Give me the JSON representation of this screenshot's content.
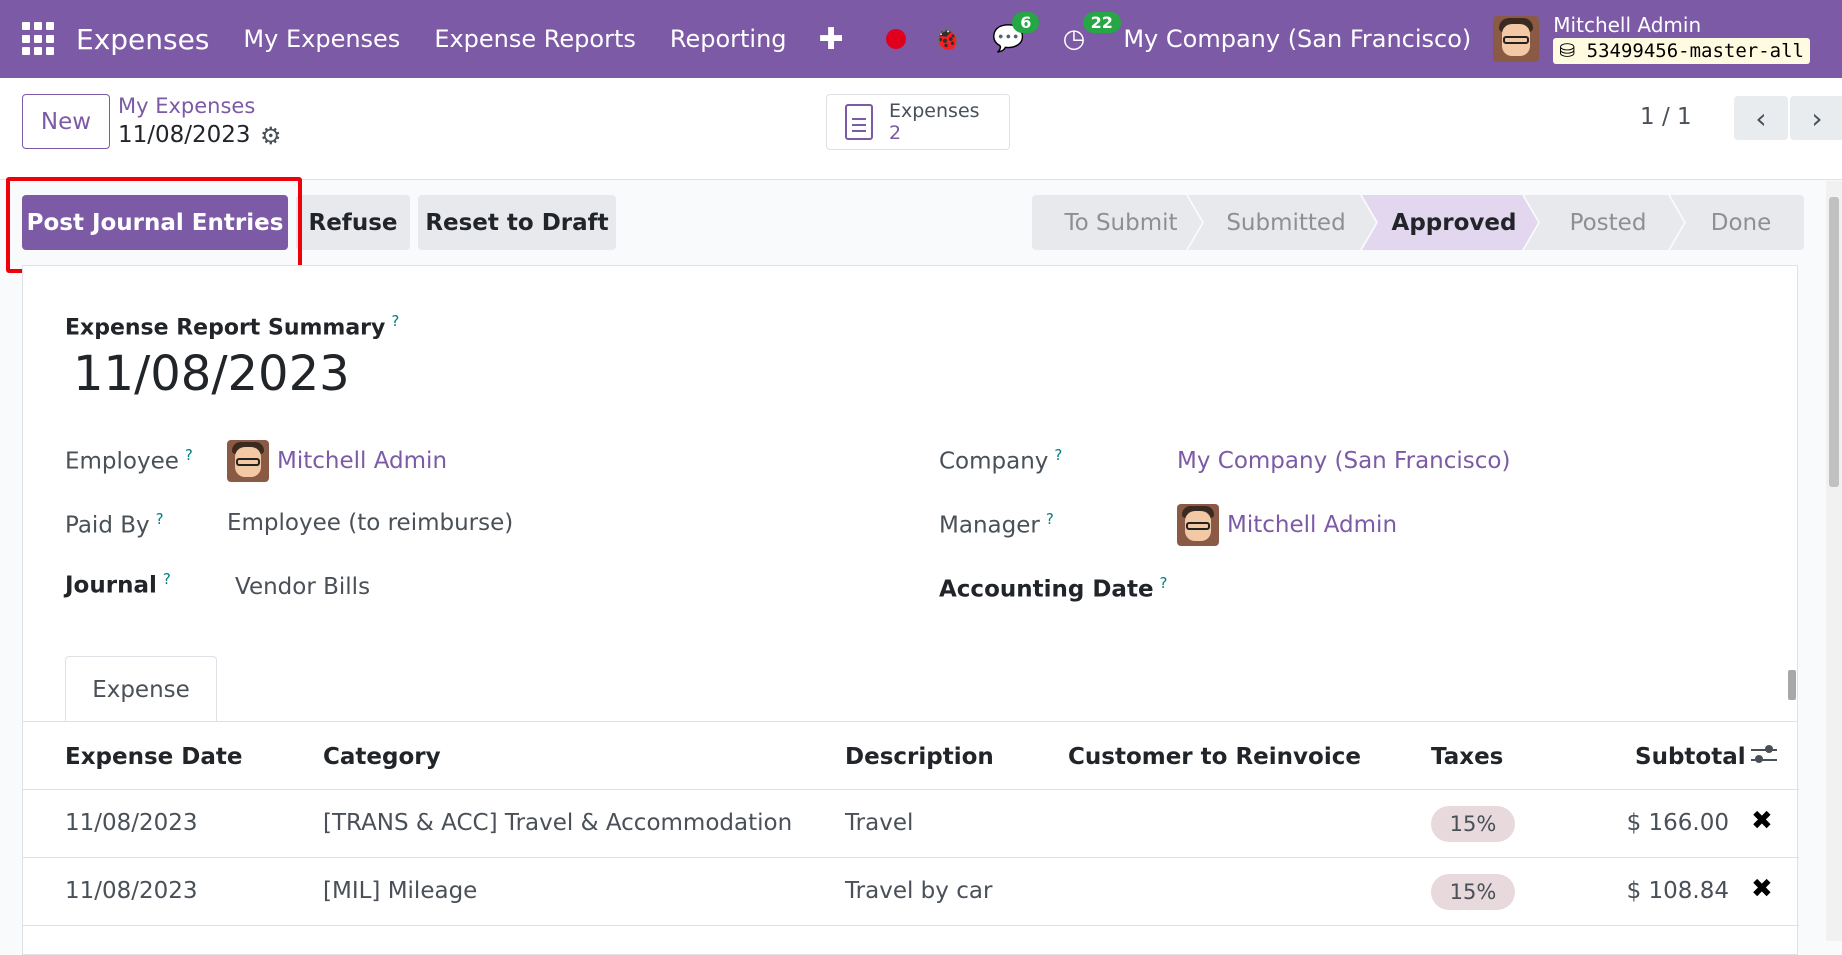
{
  "navbar": {
    "app_name": "Expenses",
    "menu": [
      "My Expenses",
      "Expense Reports",
      "Reporting"
    ],
    "plus": "✚",
    "chat_badge": "6",
    "activity_badge": "22",
    "company": "My Company (San Francisco)",
    "user_name": "Mitchell Admin",
    "database": "53499456-master-all",
    "colors": {
      "brand": "#7c5aa6",
      "badge": "#26a645",
      "record": "#e0001e"
    }
  },
  "control": {
    "new_label": "New",
    "breadcrumb_parent": "My Expenses",
    "record_title": "11/08/2023",
    "smart_button": {
      "label": "Expenses",
      "value": "2"
    },
    "pager": "1 / 1"
  },
  "status": {
    "post_label": "Post Journal Entries",
    "refuse_label": "Refuse",
    "reset_label": "Reset to Draft",
    "stages": [
      "To Submit",
      "Submitted",
      "Approved",
      "Posted",
      "Done"
    ],
    "active_stage": "Approved"
  },
  "form": {
    "summary_label": "Expense Report Summary",
    "summary_value": "11/08/2023",
    "employee_label": "Employee",
    "employee_value": "Mitchell Admin",
    "paid_by_label": "Paid By",
    "paid_by_value": "Employee (to reimburse)",
    "journal_label": "Journal",
    "journal_value": "Vendor Bills",
    "company_label": "Company",
    "company_value": "My Company (San Francisco)",
    "manager_label": "Manager",
    "manager_value": "Mitchell Admin",
    "accounting_date_label": "Accounting Date",
    "help_mark": "?",
    "tab_label": "Expense"
  },
  "table": {
    "columns": [
      "Expense Date",
      "Category",
      "Description",
      "Customer to Reinvoice",
      "Taxes",
      "Subtotal"
    ],
    "rows": [
      {
        "date": "11/08/2023",
        "category": "[TRANS & ACC] Travel & Accommodation",
        "description": "Travel",
        "customer": "",
        "tax": "15%",
        "subtotal": "$ 166.00"
      },
      {
        "date": "11/08/2023",
        "category": "[MIL] Mileage",
        "description": "Travel by car",
        "customer": "",
        "tax": "15%",
        "subtotal": "$ 108.84"
      }
    ]
  }
}
